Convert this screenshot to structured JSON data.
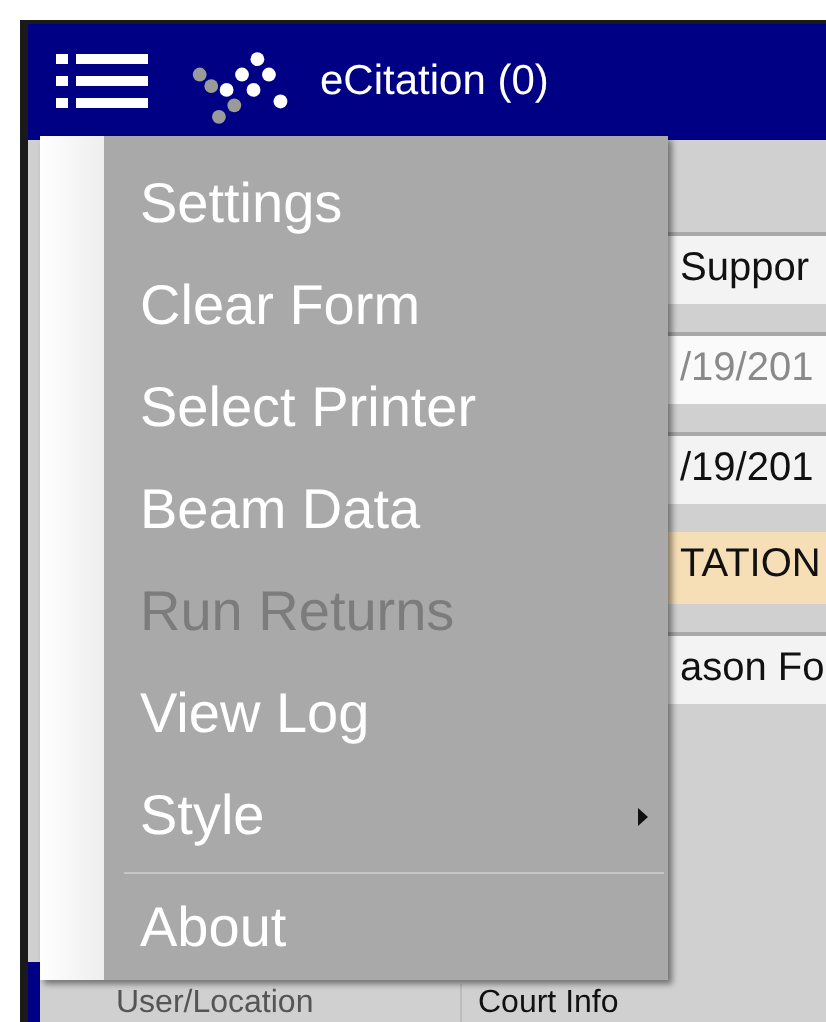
{
  "window": {
    "title": "eCitation (0)"
  },
  "form": {
    "fields": [
      {
        "value": "Suppor",
        "kind": "text"
      },
      {
        "value": "/19/201",
        "kind": "readonly"
      },
      {
        "value": "/19/201",
        "kind": "text"
      },
      {
        "value": "TATION",
        "kind": "banner"
      },
      {
        "value": "ason Fo",
        "kind": "text"
      }
    ],
    "tabs": [
      {
        "label": "User/Location",
        "selected": false
      },
      {
        "label": "Court Info",
        "selected": true
      }
    ]
  },
  "menu": {
    "items": [
      {
        "kind": "item",
        "label": "Settings",
        "disabled": false
      },
      {
        "kind": "item",
        "label": "Clear Form",
        "disabled": false
      },
      {
        "kind": "item",
        "label": "Select Printer",
        "disabled": false
      },
      {
        "kind": "item",
        "label": "Beam Data",
        "disabled": false
      },
      {
        "kind": "item",
        "label": "Run Returns",
        "disabled": true
      },
      {
        "kind": "item",
        "label": "View Log",
        "disabled": false
      },
      {
        "kind": "submenu",
        "label": "Style",
        "disabled": false
      },
      {
        "kind": "separator"
      },
      {
        "kind": "item",
        "label": "About",
        "disabled": false
      }
    ]
  }
}
